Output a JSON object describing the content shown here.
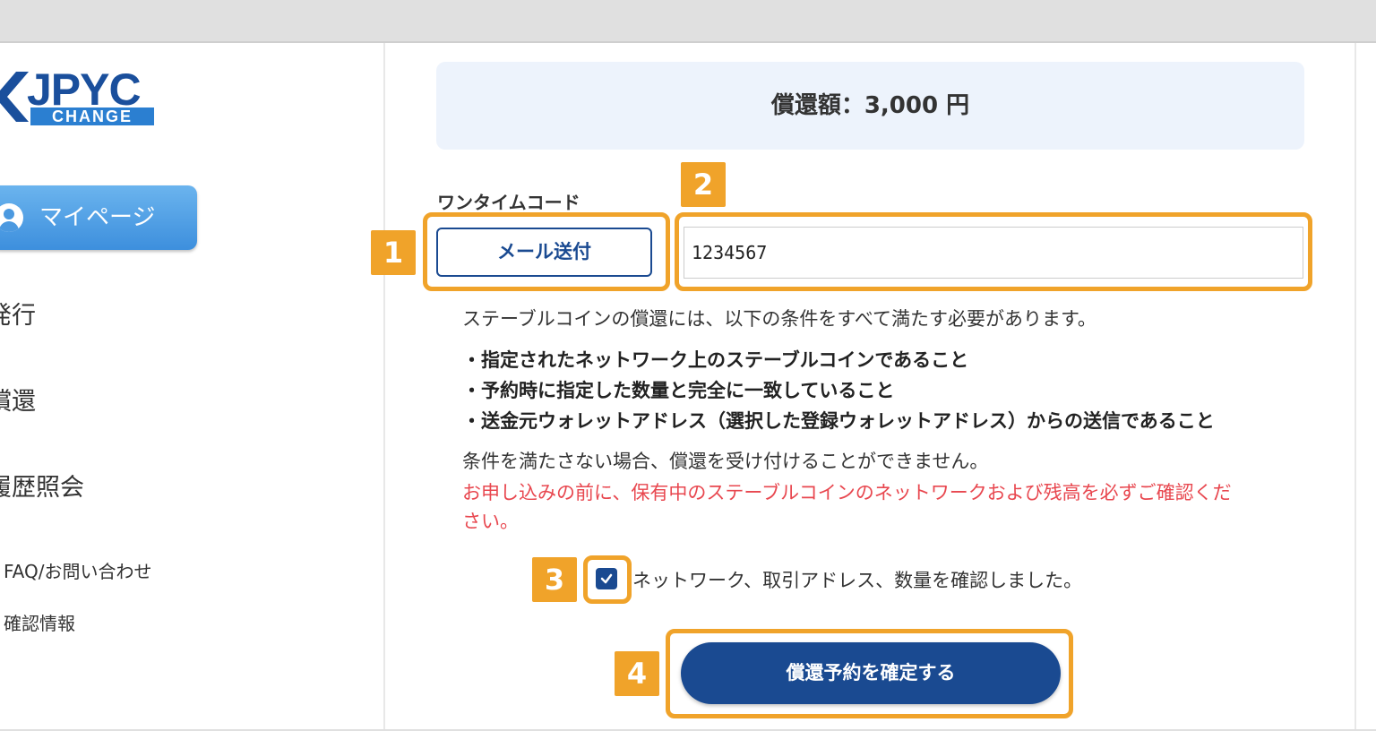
{
  "logo": {
    "main_text": "JPYC",
    "sub_text": "CHANGE"
  },
  "sidebar": {
    "mypage_label": "マイページ",
    "items": [
      {
        "label": "発行"
      },
      {
        "label": "償還"
      },
      {
        "label": "履歴照会"
      },
      {
        "label": "FAQ/お問い合わせ"
      },
      {
        "label": "確認情報"
      }
    ]
  },
  "main": {
    "amount_text": "償還額：3,000 円",
    "otp_label": "ワンタイムコード",
    "mail_button_label": "メール送付",
    "otp_value": "1234567",
    "intro": "ステーブルコインの償還には、以下の条件をすべて満たす必要があります。",
    "conditions": [
      "・指定されたネットワーク上のステーブルコインであること",
      "・予約時に指定した数量と完全に一致していること",
      "・送金元ウォレットアドレス（選択した登録ウォレットアドレス）からの送信であること"
    ],
    "note": "条件を満たさない場合、償還を受け付けることができません。",
    "warning_line1": "お申し込みの前に、保有中のステーブルコインのネットワークおよび残高を必ずご確認くだ",
    "warning_line2": "さい。",
    "checkbox_label": "ネットワーク、取引アドレス、数量を確認しました。",
    "checkbox_checked": true,
    "confirm_button_label": "償還予約を確定する"
  },
  "badges": [
    "1",
    "2",
    "3",
    "4"
  ],
  "colors": {
    "brand": "#1a4a91",
    "highlight": "#f0a32a",
    "warning": "#e8474f",
    "amount_bg": "#edf3fc",
    "sidebar_button": "#4b99e0"
  }
}
